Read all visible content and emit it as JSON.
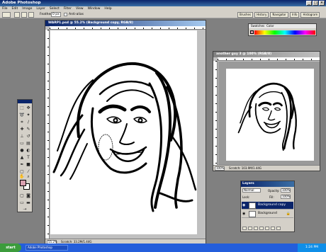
{
  "app": {
    "title": "Adobe Photoshop",
    "window_buttons": [
      "_",
      "□",
      "×"
    ]
  },
  "menu": [
    "File",
    "Edit",
    "Image",
    "Layer",
    "Select",
    "Filter",
    "View",
    "Window",
    "Help"
  ],
  "options_bar": {
    "feather_label": "Feather:",
    "feather_value": "0 px",
    "antialias_label": "Anti-alias"
  },
  "palette_well": [
    "Brushes",
    "History",
    "Navigator",
    "Info",
    "Histogram"
  ],
  "doc_main": {
    "title": "WARP1.psd @ 55.2% (Background copy, RGB/8)",
    "zoom": "55.2%",
    "scratch": "Scratch: 33.2M/1.44G"
  },
  "doc_second": {
    "title": "another guy 3 @ 100% (RGB/8)",
    "zoom": "100%",
    "scratch": "Scratch: 103.9M/1.44G"
  },
  "color_palette": {
    "tabs": [
      "Swatches",
      "Color"
    ]
  },
  "layers_palette": {
    "title": "Layers",
    "blend_mode": "Normal",
    "opacity_label": "Opacity:",
    "opacity_value": "100%",
    "lock_label": "Lock:",
    "fill_label": "Fill:",
    "fill_value": "100%",
    "layers": [
      {
        "name": "Background copy",
        "active": true
      },
      {
        "name": "Background",
        "active": false
      }
    ]
  },
  "taskbar": {
    "start_label": "start",
    "task_item": "Adobe Photoshop",
    "clock": "1:24 PM"
  },
  "colors": {
    "foreground_swatch": "#d9a0b0",
    "titlebar": "#0a246a",
    "workspace": "#808080"
  }
}
